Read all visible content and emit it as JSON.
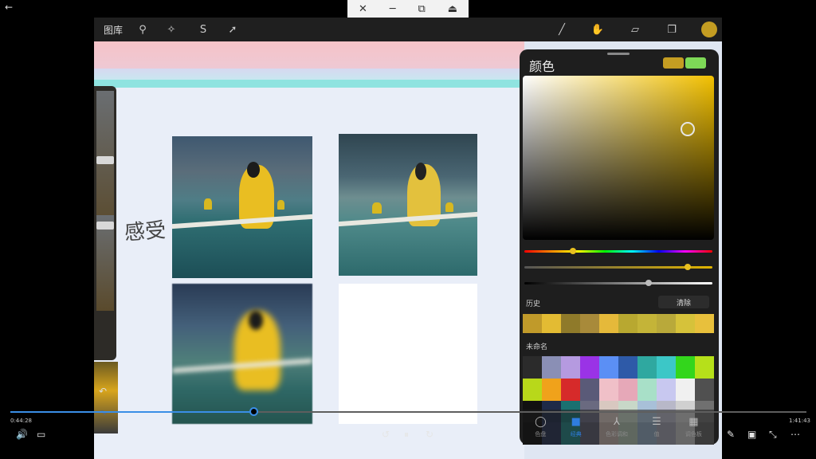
{
  "window_controls": {
    "close": "✕",
    "minimize": "─",
    "resize": "⧉",
    "restore": "⏏"
  },
  "back_glyph": "←",
  "procreate": {
    "gallery_label": "图库",
    "toolbar_left": [
      {
        "icon": "wrench-icon",
        "glyph": "⚲"
      },
      {
        "icon": "magic-wand-icon",
        "glyph": "✧"
      },
      {
        "icon": "selection-s-icon",
        "glyph": "S"
      },
      {
        "icon": "transform-arrow-icon",
        "glyph": "➚"
      }
    ],
    "toolbar_right": [
      {
        "icon": "brush-icon",
        "glyph": "╱"
      },
      {
        "icon": "smudge-icon",
        "glyph": "✋"
      },
      {
        "icon": "eraser-icon",
        "glyph": "▱"
      },
      {
        "icon": "layers-icon",
        "glyph": "❐"
      }
    ],
    "current_color": "#c49d22",
    "handwriting": "感受",
    "sidebar": {
      "undo": "↶",
      "redo": "↷"
    }
  },
  "color_panel": {
    "title": "颜色",
    "current_swatch": "#c49d22",
    "previous_swatch": "#7ed957",
    "hue_level": 0.26,
    "saturation_level": 0.87,
    "value_level": 0.66,
    "history_label": "历史",
    "clear_label": "清除",
    "history": [
      "#c09a2a",
      "#e3bb33",
      "#8f7a2a",
      "#a88a3a",
      "#e5b93a",
      "#b8a830",
      "#c4b438",
      "#b9a93a",
      "#d6c23a",
      "#e8c03c"
    ],
    "palette_label": "未命名",
    "palette": [
      "#2b2b2b",
      "#8a8fb5",
      "#b59ae0",
      "#9a33e6",
      "#5b8ff5",
      "#2e5aa8",
      "#2fa8a0",
      "#3cc7c7",
      "#33d61c",
      "#b6e01a",
      "#b8d81a",
      "#f0a21b",
      "#d62a2a",
      "#5a5a78",
      "#f0c0c8",
      "#e6a8b8",
      "#a8e0c8",
      "#c8c8f0",
      "#f0f0f0",
      "#505050",
      "#111111",
      "#1e2a48",
      "#1a7070",
      "#6a6a80",
      "#d8c8c0",
      "#c8d8c8",
      "#a8c0d8",
      "#b8b8c8",
      "#d0d0d0",
      "#707070",
      "#0a0a0a",
      "#243050",
      "#208080",
      "#5a5a6a",
      "#c0b0a8",
      "#b0c0b0",
      "#90a8c0",
      "#a0a0b0",
      "#c0c0c0",
      "#606060"
    ],
    "tabs": [
      {
        "icon": "disc-icon",
        "glyph": "◯",
        "label": "色盘",
        "active": false
      },
      {
        "icon": "classic-icon",
        "glyph": "■",
        "label": "经典",
        "active": true
      },
      {
        "icon": "harmony-icon",
        "glyph": "⅄",
        "label": "色彩调和",
        "active": false
      },
      {
        "icon": "value-icon",
        "glyph": "☰",
        "label": "值",
        "active": false
      },
      {
        "icon": "palettes-icon",
        "glyph": "▦",
        "label": "调色板",
        "active": false
      }
    ]
  },
  "player": {
    "current_time": "0:44:28",
    "total_time": "1:41:43",
    "progress": 0.305,
    "controls_left": [
      {
        "icon": "volume-icon",
        "glyph": "🔊"
      },
      {
        "icon": "subtitles-icon",
        "glyph": "▭"
      }
    ],
    "controls_center": [
      {
        "icon": "rewind-10-icon",
        "glyph": "↺"
      },
      {
        "icon": "pause-icon",
        "glyph": "⏸"
      },
      {
        "icon": "forward-30-icon",
        "glyph": "↻"
      }
    ],
    "controls_right": [
      {
        "icon": "pen-icon",
        "glyph": "✎"
      },
      {
        "icon": "miniplayer-icon",
        "glyph": "▣"
      },
      {
        "icon": "exit-fullscreen-icon",
        "glyph": "⤡"
      },
      {
        "icon": "more-icon",
        "glyph": "⋯"
      }
    ]
  }
}
